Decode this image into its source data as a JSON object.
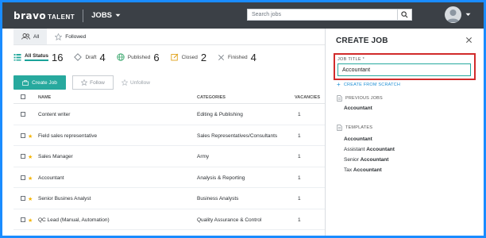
{
  "header": {
    "brand": "bravo",
    "brand_sub": "TALENT",
    "module": "JOBS",
    "search_placeholder": "Search jobs"
  },
  "tabs": [
    {
      "label": "All",
      "active": true
    },
    {
      "label": "Followed",
      "active": false
    }
  ],
  "status": [
    {
      "label": "All Status",
      "count": "16",
      "active": true
    },
    {
      "label": "Draft",
      "count": "4"
    },
    {
      "label": "Published",
      "count": "6"
    },
    {
      "label": "Closed",
      "count": "2"
    },
    {
      "label": "Finished",
      "count": "4"
    }
  ],
  "actions": {
    "create": "Create Job",
    "follow": "Follow",
    "unfollow": "Unfollow"
  },
  "table": {
    "columns": [
      "NAME",
      "CATEGORIES",
      "VACANCIES"
    ],
    "rows": [
      {
        "name": "Content writer",
        "category": "Editing & Publishing",
        "vacancies": "1",
        "starred": false
      },
      {
        "name": "Field sales representative",
        "category": "Sales Representatives/Consultants",
        "vacancies": "1",
        "starred": true
      },
      {
        "name": "Sales Manager",
        "category": "Army",
        "vacancies": "1",
        "starred": true
      },
      {
        "name": "Accountant",
        "category": "Analysis & Reporting",
        "vacancies": "1",
        "starred": true
      },
      {
        "name": "Senior Busines Analyst",
        "category": "Business Analysts",
        "vacancies": "1",
        "starred": true
      },
      {
        "name": "QC Lead (Manual, Automation)",
        "category": "Quality Assurance & Control",
        "vacancies": "1",
        "starred": true
      }
    ]
  },
  "panel": {
    "title": "CREATE JOB",
    "field_label": "JOB TITLE *",
    "field_value": "Accountant",
    "create_from_scratch": "CREATE FROM SCRATCH",
    "previous_jobs_label": "PREVIOUS JOBS",
    "previous_jobs": [
      "Accountant"
    ],
    "templates_label": "TEMPLATES",
    "templates": [
      {
        "prefix": "",
        "match": "Accountant"
      },
      {
        "prefix": "Assistant ",
        "match": "Accountant"
      },
      {
        "prefix": "Senior ",
        "match": "Accountant"
      },
      {
        "prefix": "Tax ",
        "match": "Accountant"
      }
    ]
  },
  "colors": {
    "topbar": "#3b4046",
    "accent": "#27a99e",
    "link": "#1f8fd6",
    "highlight_border": "#d12b2b",
    "star": "#f4b400",
    "outer_frame": "#1a8cff"
  }
}
